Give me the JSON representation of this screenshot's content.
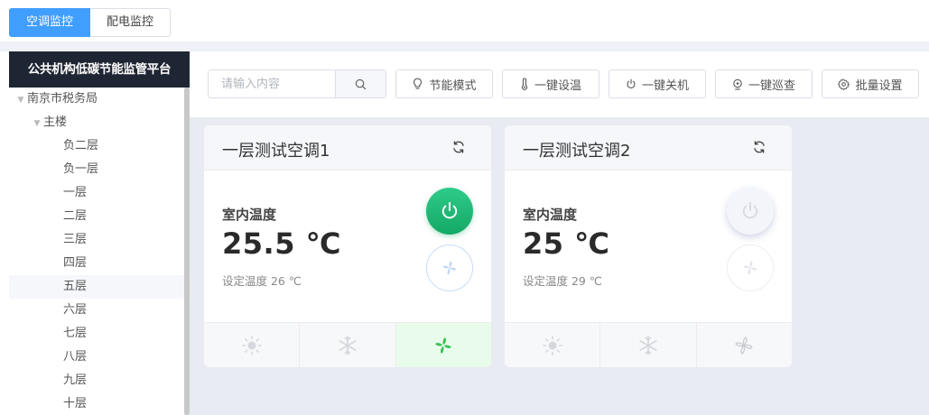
{
  "top_tabs": [
    {
      "label": "空调监控",
      "active": true
    },
    {
      "label": "配电监控",
      "active": false
    }
  ],
  "sidebar": {
    "title": "公共机构低碳节能监管平台",
    "tree": [
      {
        "label": "南京市税务局",
        "level": 0,
        "expanded": true
      },
      {
        "label": "主楼",
        "level": 1,
        "expanded": true
      },
      {
        "label": "负二层",
        "level": 2
      },
      {
        "label": "负一层",
        "level": 2
      },
      {
        "label": "一层",
        "level": 2
      },
      {
        "label": "二层",
        "level": 2
      },
      {
        "label": "三层",
        "level": 2
      },
      {
        "label": "四层",
        "level": 2
      },
      {
        "label": "五层",
        "level": 2,
        "selected": true
      },
      {
        "label": "六层",
        "level": 2
      },
      {
        "label": "七层",
        "level": 2
      },
      {
        "label": "八层",
        "level": 2
      },
      {
        "label": "九层",
        "level": 2
      },
      {
        "label": "十层",
        "level": 2
      }
    ]
  },
  "toolbar": {
    "search_placeholder": "请输入内容",
    "search_value": "",
    "buttons": {
      "energy": "节能模式",
      "set_temp": "一键设温",
      "shutdown": "一键关机",
      "patrol": "一键巡查",
      "batch": "批量设置"
    }
  },
  "cards": [
    {
      "title": "一层测试空调1",
      "indoor_label": "室内温度",
      "temperature": "25.5 ℃",
      "set_temp": "设定温度 26 ℃",
      "power": "on",
      "active_mode": "fan"
    },
    {
      "title": "一层测试空调2",
      "indoor_label": "室内温度",
      "temperature": "25 ℃",
      "set_temp": "设定温度 29 ℃",
      "power": "off",
      "active_mode": "none"
    }
  ],
  "colors": {
    "primary": "#409eff",
    "sidebar_title_bg": "#1f2633",
    "power_on": "#1ab370",
    "fan_active": "#3cc25a",
    "main_bg": "#e8ebf2"
  }
}
